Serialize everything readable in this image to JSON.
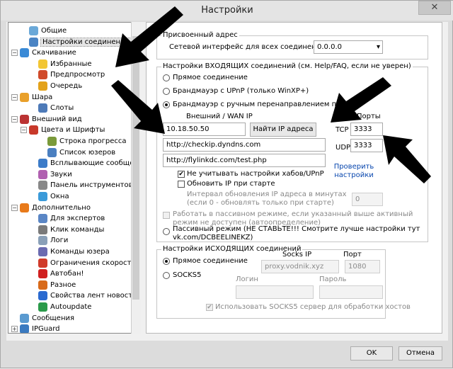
{
  "window": {
    "title": "Настройки",
    "close_label": "✕"
  },
  "tree": [
    {
      "label": "Общие",
      "indent": 1,
      "expander": "",
      "icon": "#6aa8d8"
    },
    {
      "label": "Настройки соединения",
      "indent": 1,
      "expander": "",
      "icon": "#4a84c4",
      "selected": true
    },
    {
      "label": "Скачивание",
      "indent": 0,
      "expander": "−",
      "icon": "#3a8ad6"
    },
    {
      "label": "Избранные",
      "indent": 2,
      "expander": "",
      "icon": "#f2c634"
    },
    {
      "label": "Предпросмотр",
      "indent": 2,
      "expander": "",
      "icon": "#d04a2a"
    },
    {
      "label": "Очередь",
      "indent": 2,
      "expander": "",
      "icon": "#e3a21a"
    },
    {
      "label": "Шара",
      "indent": 0,
      "expander": "−",
      "icon": "#e9a02a"
    },
    {
      "label": "Слоты",
      "indent": 2,
      "expander": "",
      "icon": "#4d7ab8"
    },
    {
      "label": "Внешний вид",
      "indent": 0,
      "expander": "−",
      "icon": "#b33"
    },
    {
      "label": "Цвета и Шрифты",
      "indent": 1,
      "expander": "−",
      "icon": "#c8392a"
    },
    {
      "label": "Строка прогресса",
      "indent": 3,
      "expander": "",
      "icon": "#7a9a3a"
    },
    {
      "label": "Список юзеров",
      "indent": 3,
      "expander": "",
      "icon": "#4a7fc0"
    },
    {
      "label": "Всплывающие сообщен",
      "indent": 2,
      "expander": "",
      "icon": "#3c7bc8"
    },
    {
      "label": "Звуки",
      "indent": 2,
      "expander": "",
      "icon": "#b060b0"
    },
    {
      "label": "Панель инструментов",
      "indent": 2,
      "expander": "",
      "icon": "#888"
    },
    {
      "label": "Окна",
      "indent": 2,
      "expander": "",
      "icon": "#3a9ad9"
    },
    {
      "label": "Дополнительно",
      "indent": 0,
      "expander": "−",
      "icon": "#e87a1a"
    },
    {
      "label": "Для экспертов",
      "indent": 2,
      "expander": "",
      "icon": "#5a86c5"
    },
    {
      "label": "Клик команды",
      "indent": 2,
      "expander": "",
      "icon": "#7a7a7a"
    },
    {
      "label": "Логи",
      "indent": 2,
      "expander": "",
      "icon": "#8aa0b8"
    },
    {
      "label": "Команды юзера",
      "indent": 2,
      "expander": "",
      "icon": "#6a6ab0"
    },
    {
      "label": "Ограничения скорости",
      "indent": 2,
      "expander": "",
      "icon": "#d03a2a"
    },
    {
      "label": "Автобан!",
      "indent": 2,
      "expander": "",
      "icon": "#d02020"
    },
    {
      "label": "Разное",
      "indent": 2,
      "expander": "",
      "icon": "#d86a1a"
    },
    {
      "label": "Свойства лент новостей",
      "indent": 2,
      "expander": "",
      "icon": "#2a6ad0"
    },
    {
      "label": "Autoupdate",
      "indent": 2,
      "expander": "",
      "icon": "#2a9a4a"
    },
    {
      "label": "Сообщения",
      "indent": 0,
      "expander": "",
      "icon": "#5a9ad0"
    },
    {
      "label": "IPGuard",
      "indent": 0,
      "expander": "+",
      "icon": "#3a7ac0"
    }
  ],
  "assigned": {
    "legend": "Присвоенный адрес",
    "label": "Сетевой интерфейс для всех соединений",
    "value": "0.0.0.0",
    "arrow": "▾"
  },
  "incoming": {
    "legend": "Настройки ВХОДЯЩИХ соединений (см. Help/FAQ, если не уверен)",
    "direct": "Прямое соединение",
    "upnp": "Брандмауэр с UPnP (только WinXP+)",
    "manual": "Брандмауэр с ручным перенаправлением портов",
    "ext_label": "Внешний / WAN IP",
    "ext_ip": "10.18.50.50",
    "find_ip": "Найти IP адреса",
    "ports_label": "Порты",
    "tcp_label": "TCP",
    "tcp_value": "3333",
    "udp_label": "UDP",
    "udp_value": "3333",
    "url1": "http://checkip.dyndns.com",
    "url2": "http://flylinkdc.com/test.php",
    "check_link": "Проверить настройки",
    "ignore_hub": "Не учитывать настройки хабов/UPnP",
    "update_ip": "Обновить IP при старте",
    "interval_line1": "Интервал обновления IP адреса в минутах",
    "interval_line2": "(если 0 - обновлять только при старте)",
    "interval_value": "0",
    "passive_line1": "Работать в пассивном режиме, если указанный выше активный",
    "passive_line2": "режим не доступен (автоопределение)",
    "passive_mode_line1": "Пассивный режим (НЕ СТАВЬТЕ!!! Смотрите лучше настройки тут",
    "passive_mode_line2": "vk.com/DCBEELINEKZ)",
    "checkmark": "✔"
  },
  "outgoing": {
    "legend": "Настройки ИСХОДЯЩИХ соединений",
    "direct": "Прямое соединение",
    "socks5": "SOCKS5",
    "socks_ip_label": "Socks IP",
    "socks_ip": "proxy.vodnik.xyz",
    "port_label": "Порт",
    "port": "1080",
    "login_label": "Логин",
    "password_label": "Пароль",
    "use_socks": "Использовать SOCKS5 сервер для обработки хостов"
  },
  "buttons": {
    "ok": "OK",
    "cancel": "Отмена"
  },
  "colors": {
    "arrow": "#000000",
    "link": "#0645ad"
  }
}
